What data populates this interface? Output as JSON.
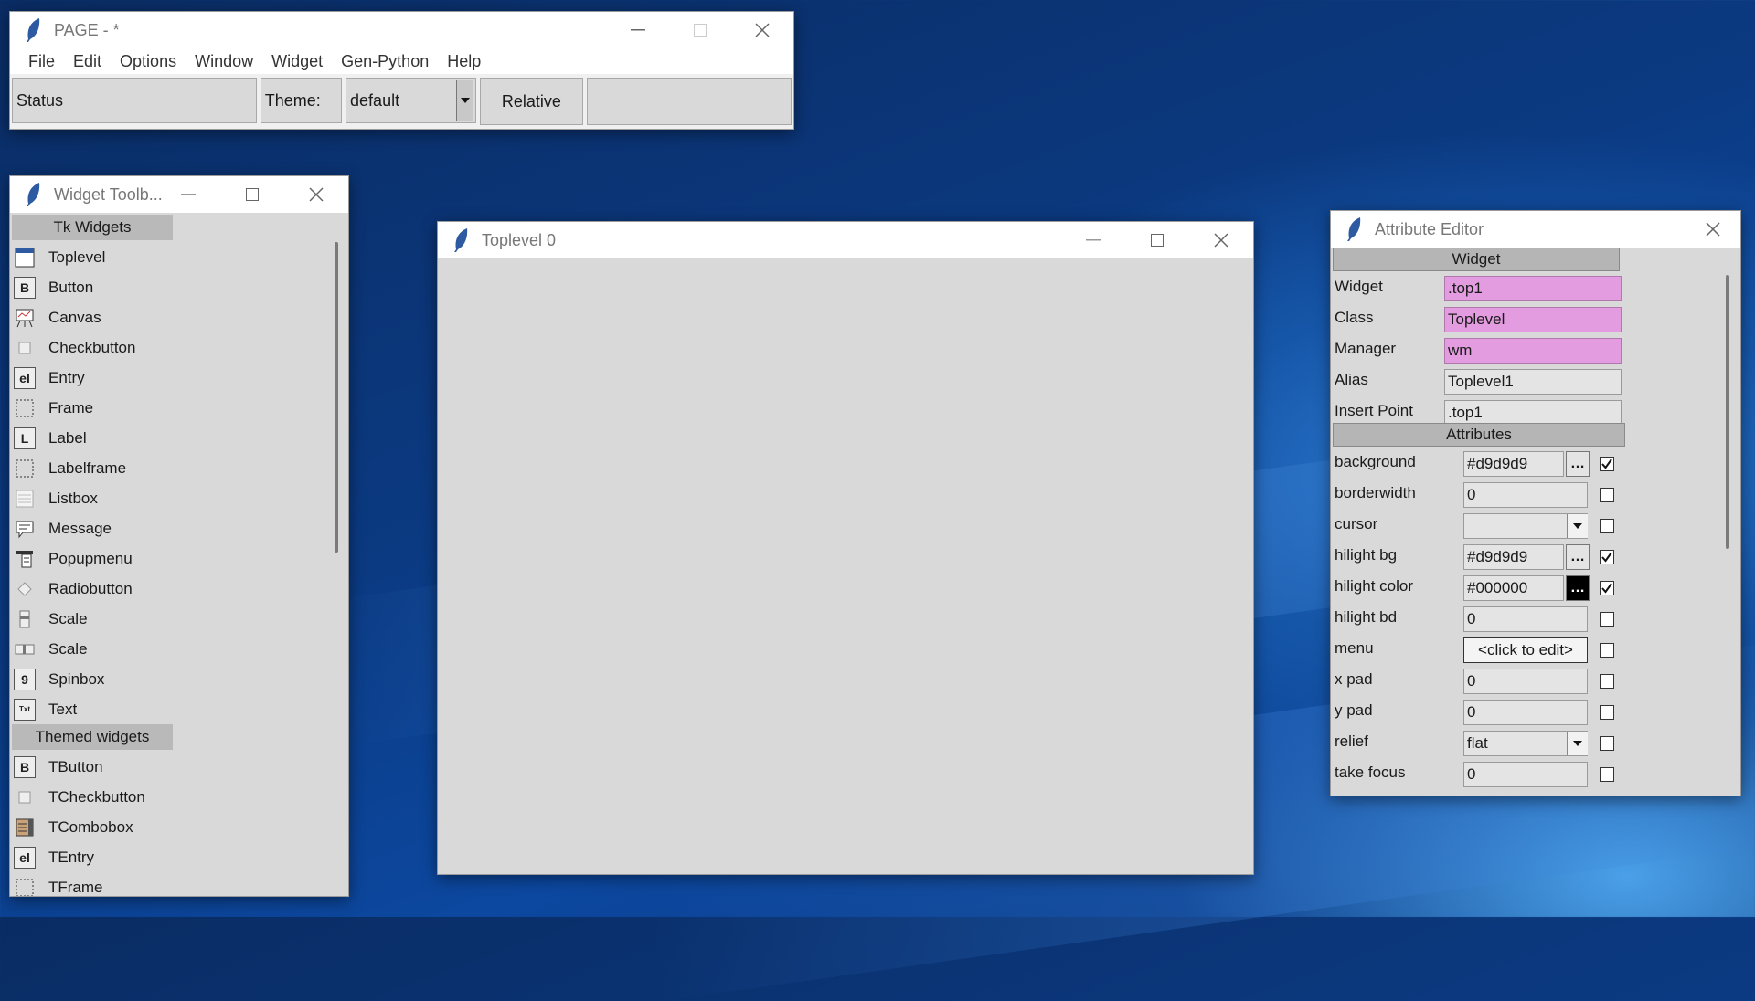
{
  "page_window": {
    "title": "PAGE - *",
    "menu": [
      "File",
      "Edit",
      "Options",
      "Window",
      "Widget",
      "Gen-Python",
      "Help"
    ],
    "status_label": "Status",
    "theme_label": "Theme:",
    "theme_value": "default",
    "relative_button": "Relative"
  },
  "toolbox": {
    "title": "Widget Toolb...",
    "tk_section": "Tk Widgets",
    "tk_items": [
      {
        "label": "Toplevel",
        "icon": "toplevel-icon"
      },
      {
        "label": "Button",
        "icon": "button-icon",
        "glyph": "B"
      },
      {
        "label": "Canvas",
        "icon": "canvas-icon"
      },
      {
        "label": "Checkbutton",
        "icon": "checkbutton-icon"
      },
      {
        "label": "Entry",
        "icon": "entry-icon",
        "glyph": "el"
      },
      {
        "label": "Frame",
        "icon": "frame-icon"
      },
      {
        "label": "Label",
        "icon": "label-icon",
        "glyph": "L"
      },
      {
        "label": "Labelframe",
        "icon": "labelframe-icon"
      },
      {
        "label": "Listbox",
        "icon": "listbox-icon"
      },
      {
        "label": "Message",
        "icon": "message-icon"
      },
      {
        "label": "Popupmenu",
        "icon": "popupmenu-icon"
      },
      {
        "label": "Radiobutton",
        "icon": "radiobutton-icon"
      },
      {
        "label": "Scale",
        "icon": "vertical-scale-icon"
      },
      {
        "label": "Scale",
        "icon": "horizontal-scale-icon"
      },
      {
        "label": "Spinbox",
        "icon": "spinbox-icon",
        "glyph": "9"
      },
      {
        "label": "Text",
        "icon": "text-icon",
        "glyph": "Txt"
      }
    ],
    "themed_section": "Themed widgets",
    "themed_items": [
      {
        "label": "TButton",
        "icon": "tbutton-icon",
        "glyph": "B"
      },
      {
        "label": "TCheckbutton",
        "icon": "tcheckbutton-icon"
      },
      {
        "label": "TCombobox",
        "icon": "tcombobox-icon"
      },
      {
        "label": "TEntry",
        "icon": "tentry-icon",
        "glyph": "el"
      },
      {
        "label": "TFrame",
        "icon": "tframe-icon"
      }
    ]
  },
  "toplevel_window": {
    "title": "Toplevel 0"
  },
  "attribute_editor": {
    "title": "Attribute Editor",
    "widget_section": "Widget",
    "widget_rows": [
      {
        "label": "Widget",
        "value": ".top1",
        "highlight": true
      },
      {
        "label": "Class",
        "value": "Toplevel",
        "highlight": true
      },
      {
        "label": "Manager",
        "value": "wm",
        "highlight": true
      },
      {
        "label": "Alias",
        "value": "Toplevel1",
        "highlight": false
      },
      {
        "label": "Insert Point",
        "value": ".top1",
        "highlight": false
      }
    ],
    "attributes_section": "Attributes",
    "attribute_rows": [
      {
        "label": "background",
        "value": "#d9d9d9",
        "control": "dots",
        "checked": true
      },
      {
        "label": "borderwidth",
        "value": "0",
        "control": "none",
        "checked": false
      },
      {
        "label": "cursor",
        "value": "",
        "control": "dropdown",
        "checked": false
      },
      {
        "label": "hilight bg",
        "value": "#d9d9d9",
        "control": "dots",
        "checked": true
      },
      {
        "label": "hilight color",
        "value": "#000000",
        "control": "dots-black",
        "checked": true
      },
      {
        "label": "hilight bd",
        "value": "0",
        "control": "none",
        "checked": false
      },
      {
        "label": "menu",
        "value": "<click to edit>",
        "control": "button",
        "checked": false
      },
      {
        "label": "x pad",
        "value": "0",
        "control": "none",
        "checked": false
      },
      {
        "label": "y pad",
        "value": "0",
        "control": "none",
        "checked": false
      },
      {
        "label": "relief",
        "value": "flat",
        "control": "dropdown",
        "checked": false
      },
      {
        "label": "take focus",
        "value": "0",
        "control": "none",
        "checked": false
      }
    ]
  },
  "colors": {
    "window_bg": "#d9d9d9",
    "highlight_field": "#e39ce0",
    "section_header": "#b9b9b9"
  }
}
